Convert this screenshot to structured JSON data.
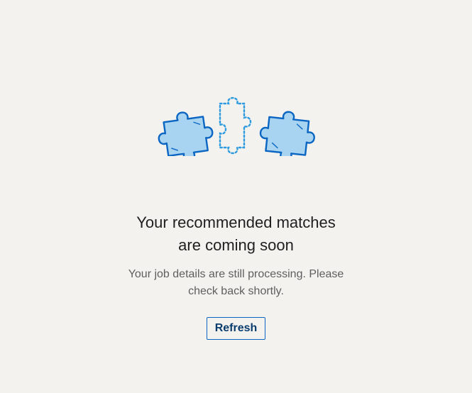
{
  "empty_state": {
    "headline_line1": "Your recommended matches",
    "headline_line2": "are coming soon",
    "subtext": "Your job details are still processing. Please check back shortly.",
    "refresh_label": "Refresh"
  },
  "illustration": {
    "name": "puzzle-pieces-illustration",
    "icons": [
      "puzzle-piece-icon",
      "puzzle-piece-outline-icon",
      "puzzle-piece-icon"
    ]
  },
  "colors": {
    "background": "#f3f2ef",
    "piece_fill": "#a8d4f2",
    "piece_stroke": "#0a66c2",
    "dotted_outline": "#2e9be0",
    "button_border": "#0a66c2",
    "button_text": "#0a3d6e"
  }
}
